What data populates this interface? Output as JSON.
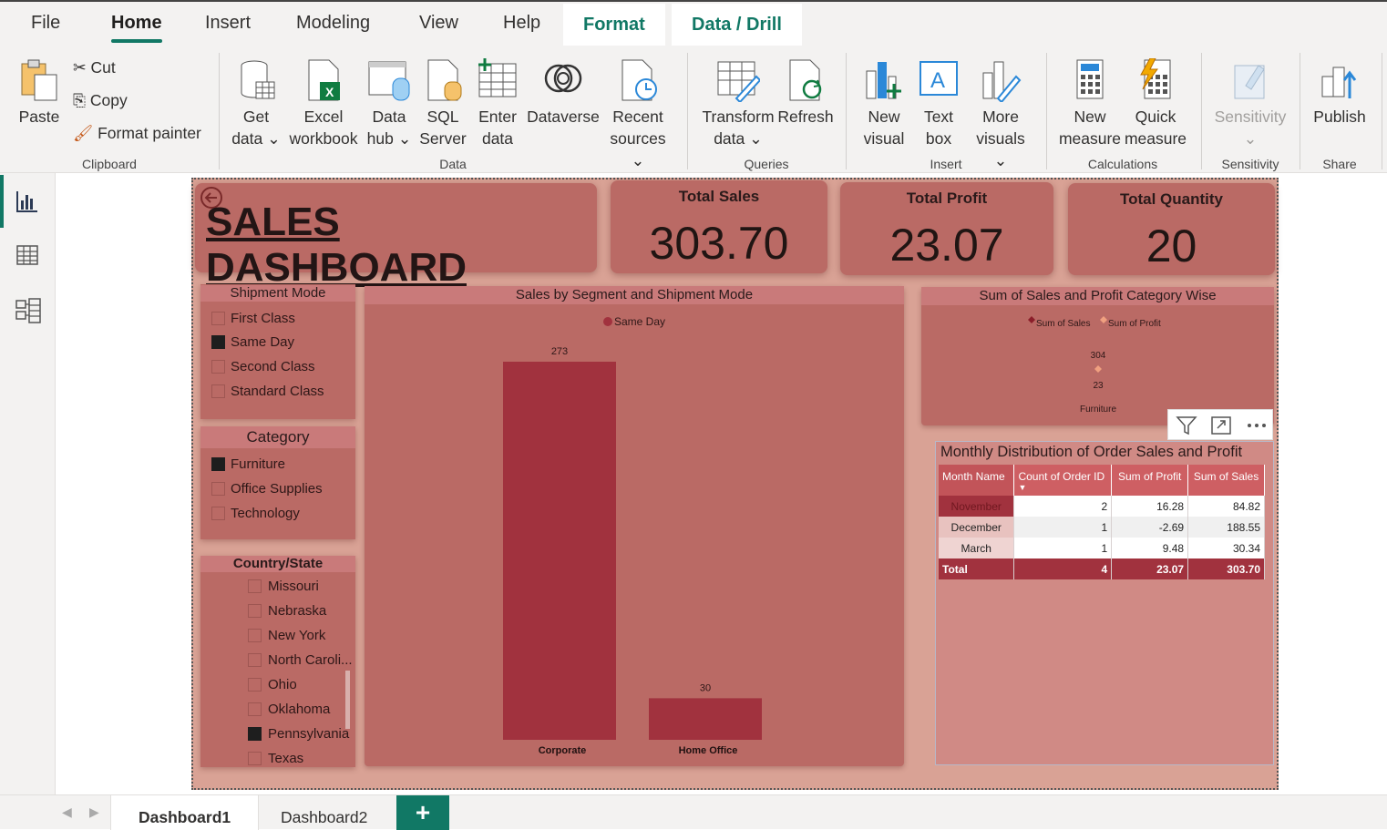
{
  "menu": {
    "tabs": [
      "File",
      "Home",
      "Insert",
      "Modeling",
      "View",
      "Help"
    ],
    "context_tabs": [
      "Format",
      "Data / Drill"
    ]
  },
  "ribbon": {
    "clipboard": {
      "paste": "Paste",
      "cut": "Cut",
      "copy": "Copy",
      "format_painter": "Format painter",
      "label": "Clipboard"
    },
    "data": {
      "get_data": [
        "Get",
        "data"
      ],
      "excel": [
        "Excel",
        "workbook"
      ],
      "data_hub": [
        "Data",
        "hub"
      ],
      "sql": [
        "SQL",
        "Server"
      ],
      "enter": [
        "Enter",
        "data"
      ],
      "dataverse": "Dataverse",
      "recent": [
        "Recent",
        "sources"
      ],
      "label": "Data"
    },
    "queries": {
      "transform": [
        "Transform",
        "data"
      ],
      "refresh": "Refresh",
      "label": "Queries"
    },
    "insert": {
      "new_visual": [
        "New",
        "visual"
      ],
      "text_box": [
        "Text",
        "box"
      ],
      "more_visuals": [
        "More",
        "visuals"
      ],
      "label": "Insert"
    },
    "calculations": {
      "new_measure": [
        "New",
        "measure"
      ],
      "quick_measure": [
        "Quick",
        "measure"
      ],
      "label": "Calculations"
    },
    "sensitivity": {
      "sensitivity": "Sensitivity",
      "label": "Sensitivity"
    },
    "share": {
      "publish": "Publish",
      "label": "Share"
    }
  },
  "pages": {
    "tabs": [
      "Dashboard1",
      "Dashboard2"
    ],
    "add": "+"
  },
  "dashboard": {
    "title": "SALES DASHBOARD",
    "kpis": [
      {
        "title": "Total Sales",
        "value": "303.70"
      },
      {
        "title": "Total Profit",
        "value": "23.07"
      },
      {
        "title": "Total Quantity",
        "value": "20"
      }
    ],
    "shipment_slicer": {
      "header": "Shipment Mode",
      "options": [
        {
          "label": "First Class",
          "checked": false
        },
        {
          "label": "Same Day",
          "checked": true
        },
        {
          "label": "Second Class",
          "checked": false
        },
        {
          "label": "Standard Class",
          "checked": false
        }
      ]
    },
    "category_slicer": {
      "header": "Category",
      "options": [
        {
          "label": "Furniture",
          "checked": true
        },
        {
          "label": "Office Supplies",
          "checked": false
        },
        {
          "label": "Technology",
          "checked": false
        }
      ]
    },
    "state_slicer": {
      "header": "Country/State",
      "options": [
        {
          "label": "Missouri",
          "checked": false
        },
        {
          "label": "Nebraska",
          "checked": false
        },
        {
          "label": "New York",
          "checked": false
        },
        {
          "label": "North Caroli...",
          "checked": false
        },
        {
          "label": "Ohio",
          "checked": false
        },
        {
          "label": "Oklahoma",
          "checked": false
        },
        {
          "label": "Pennsylvania",
          "checked": true
        },
        {
          "label": "Texas",
          "checked": false
        }
      ]
    },
    "bar_chart": {
      "title": "Sales by Segment and Shipment Mode"
    },
    "combo_chart": {
      "title": "Sum of Sales and Profit Category Wise"
    },
    "table": {
      "title": "Monthly Distribution of Order Sales and Profit",
      "headers": [
        "Month Name",
        "Count of Order ID",
        "Sum of Profit",
        "Sum of Sales"
      ],
      "rows": [
        [
          "November",
          "2",
          "16.28",
          "84.82"
        ],
        [
          "December",
          "1",
          "-2.69",
          "188.55"
        ],
        [
          "March",
          "1",
          "9.48",
          "30.34"
        ]
      ],
      "total": [
        "Total",
        "4",
        "23.07",
        "303.70"
      ]
    }
  },
  "chart_data": [
    {
      "type": "bar",
      "title": "Sales by Segment and Shipment Mode",
      "categories": [
        "Corporate",
        "Home Office"
      ],
      "series": [
        {
          "name": "Same Day",
          "values": [
            273,
            30
          ]
        }
      ],
      "colors": {
        "Same Day": "#a1323e"
      }
    },
    {
      "type": "line",
      "title": "Sum of Sales and Profit Category Wise",
      "categories": [
        "Furniture"
      ],
      "series": [
        {
          "name": "Sum of Sales",
          "values": [
            304
          ]
        },
        {
          "name": "Sum of Profit",
          "values": [
            23
          ]
        }
      ],
      "colors": {
        "Sum of Sales": "#8b1e2a",
        "Sum of Profit": "#f0a080"
      }
    }
  ],
  "colors": {
    "accent": "#117865",
    "canvas_bg": "#d9a295",
    "card_bg": "#ba6a65",
    "bar": "#a1323e"
  }
}
